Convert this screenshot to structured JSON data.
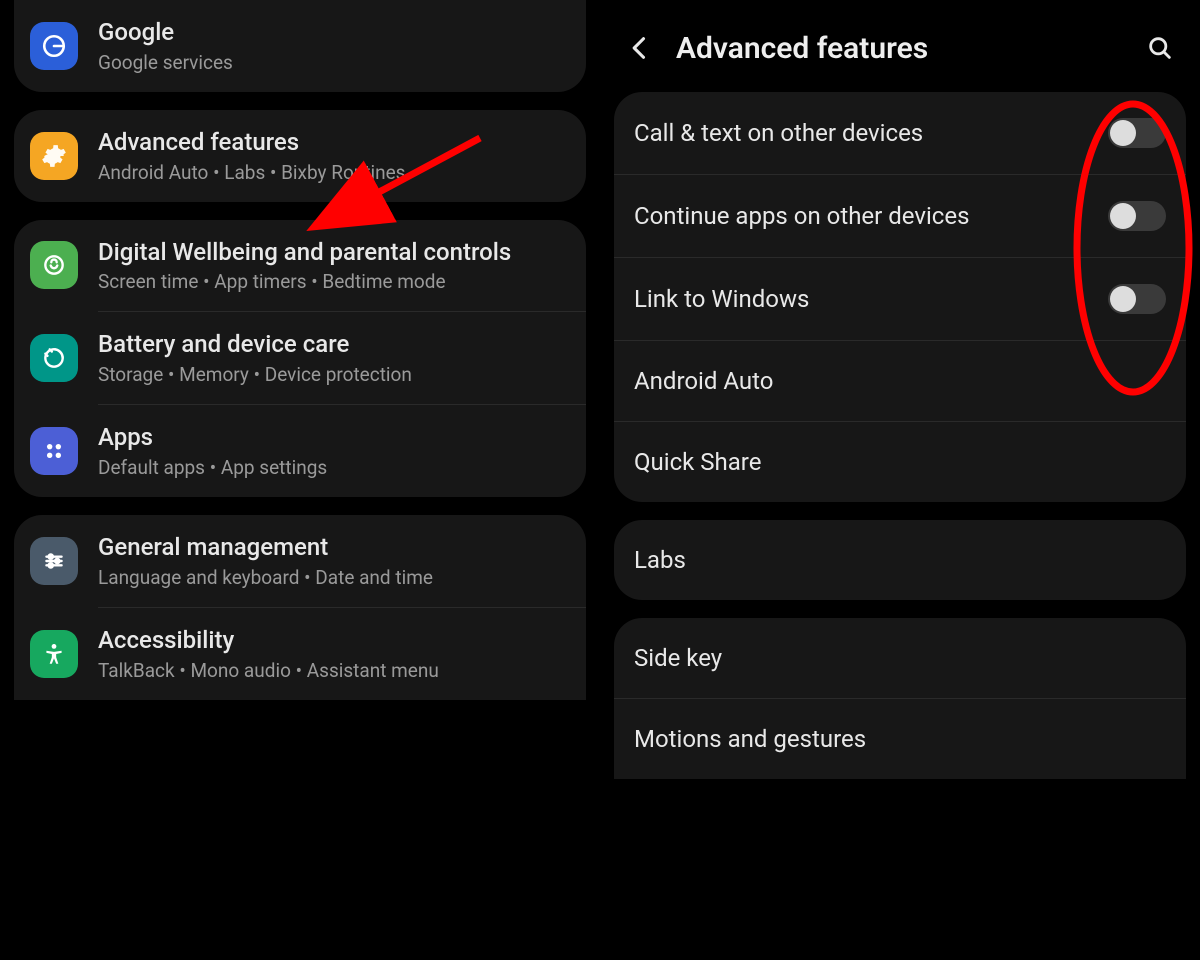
{
  "left": {
    "items": [
      {
        "title": "Google",
        "sub": "Google services"
      },
      {
        "title": "Advanced features",
        "sub": "Android Auto  •  Labs  •  Bixby Routines"
      },
      {
        "title": "Digital Wellbeing and parental controls",
        "sub": "Screen time  •  App timers  •  Bedtime mode"
      },
      {
        "title": "Battery and device care",
        "sub": "Storage  •  Memory  •  Device protection"
      },
      {
        "title": "Apps",
        "sub": "Default apps  •  App settings"
      },
      {
        "title": "General management",
        "sub": "Language and keyboard  •  Date and time"
      },
      {
        "title": "Accessibility",
        "sub": "TalkBack  •  Mono audio  •  Assistant menu"
      }
    ]
  },
  "right": {
    "header": "Advanced features",
    "group1": [
      {
        "label": "Call & text on other devices",
        "toggle": true,
        "on": false
      },
      {
        "label": "Continue apps on other devices",
        "toggle": true,
        "on": false
      },
      {
        "label": "Link to Windows",
        "toggle": true,
        "on": false
      },
      {
        "label": "Android Auto",
        "toggle": false
      },
      {
        "label": "Quick Share",
        "toggle": false
      }
    ],
    "group2": [
      {
        "label": "Labs",
        "toggle": false
      }
    ],
    "group3": [
      {
        "label": "Side key",
        "toggle": false
      },
      {
        "label": "Motions and gestures",
        "toggle": false
      }
    ]
  },
  "colors": {
    "annotation": "#ff0000"
  }
}
